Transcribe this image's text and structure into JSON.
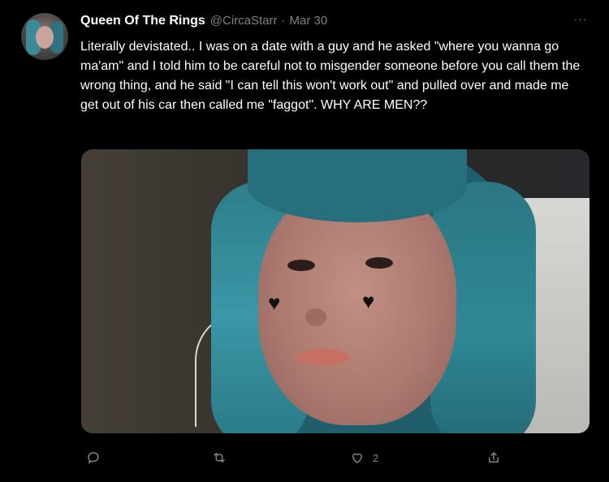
{
  "tweet": {
    "author": {
      "display_name": "Queen Of The Rings",
      "handle": "@CircaStarr",
      "separator": "·",
      "date": "Mar 30"
    },
    "more_label": "···",
    "text": "Literally devistated.. I was on a date with a guy and he asked \"where you wanna go ma'am\" and I told him to be careful not to misgender someone before you call them the wrong thing, and he said \"I can tell this won't work out\" and pulled over and made me get out of his car then called me \"faggot\". WHY ARE MEN??",
    "media": {
      "sticker_icons": [
        "heart-icon",
        "heart-icon"
      ]
    },
    "actions": {
      "reply": {
        "icon": "reply-icon",
        "count": ""
      },
      "retweet": {
        "icon": "retweet-icon",
        "count": ""
      },
      "like": {
        "icon": "heart-outline-icon",
        "count": "2"
      },
      "share": {
        "icon": "share-icon",
        "count": ""
      }
    }
  },
  "theme": {
    "background": "#000000",
    "text": "#ffffff",
    "muted": "#7b8289",
    "hair": "#2f8896"
  }
}
